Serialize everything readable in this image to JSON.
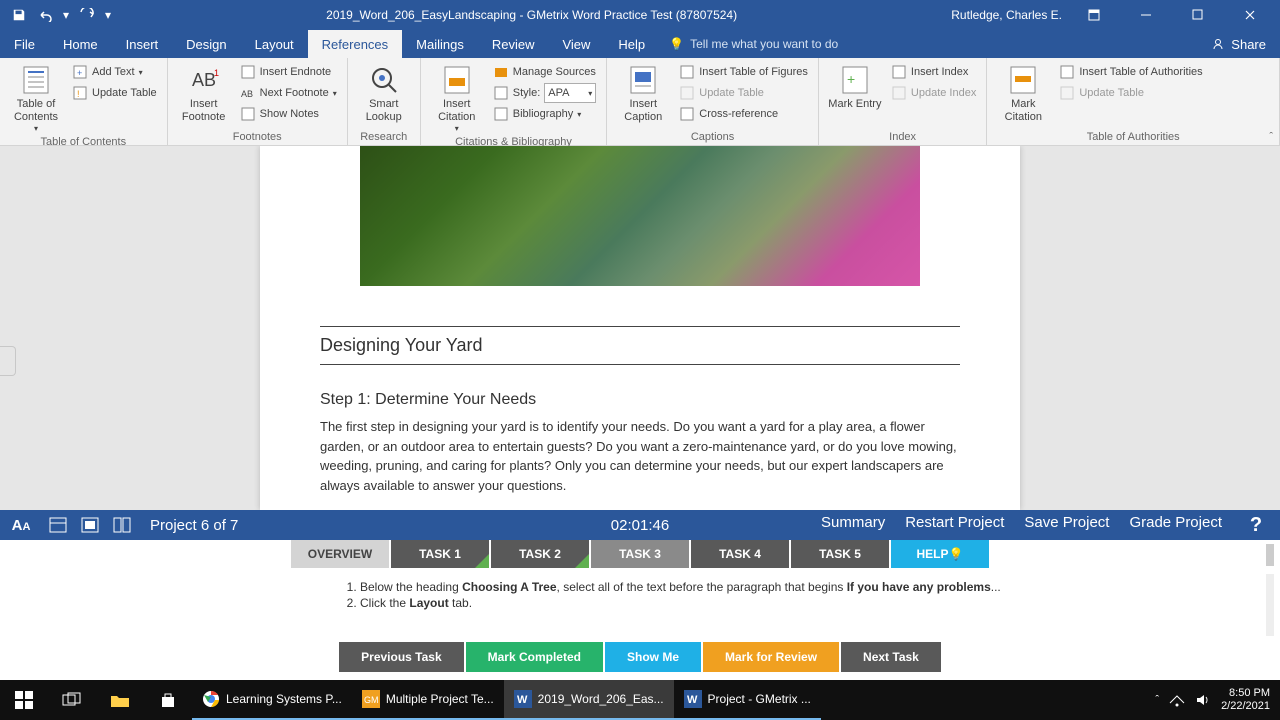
{
  "titlebar": {
    "doc_name": "2019_Word_206_EasyLandscaping",
    "app_name": "GMetrix Word Practice Test (87807524)",
    "user": "Rutledge, Charles E."
  },
  "menu": {
    "tabs": [
      "File",
      "Home",
      "Insert",
      "Design",
      "Layout",
      "References",
      "Mailings",
      "Review",
      "View",
      "Help"
    ],
    "active": "References",
    "tell_me": "Tell me what you want to do",
    "share": "Share"
  },
  "ribbon": {
    "toc": {
      "label": "Table of Contents",
      "big": "Table of Contents",
      "add_text": "Add Text",
      "update": "Update Table"
    },
    "footnotes": {
      "label": "Footnotes",
      "big": "Insert Footnote",
      "endnote": "Insert Endnote",
      "next": "Next Footnote",
      "show": "Show Notes"
    },
    "research": {
      "label": "Research",
      "big": "Smart Lookup"
    },
    "citations": {
      "label": "Citations & Bibliography",
      "big": "Insert Citation",
      "manage": "Manage Sources",
      "style": "Style:",
      "style_val": "APA",
      "biblio": "Bibliography"
    },
    "captions": {
      "label": "Captions",
      "big": "Insert Caption",
      "table_fig": "Insert Table of Figures",
      "update": "Update Table",
      "cross": "Cross-reference"
    },
    "index": {
      "label": "Index",
      "big": "Mark Entry",
      "insert": "Insert Index",
      "update": "Update Index"
    },
    "toa": {
      "label": "Table of Authorities",
      "big": "Mark Citation",
      "insert": "Insert Table of Authorities",
      "update": "Update Table"
    }
  },
  "document": {
    "section_title": "Designing Your Yard",
    "step_title": "Step 1: Determine Your Needs",
    "body": "The first step in designing your yard is to identify your needs. Do you want a yard for a play area, a flower garden, or an outdoor area to entertain guests? Do you want a zero-maintenance yard, or do you love mowing, weeding, pruning, and caring for plants? Only you can determine your needs, but our expert landscapers are always available to answer your questions."
  },
  "gmetrix": {
    "project": "Project 6 of 7",
    "timer": "02:01:46",
    "links": [
      "Summary",
      "Restart Project",
      "Save Project",
      "Grade Project"
    ],
    "tasks": {
      "overview": "OVERVIEW",
      "items": [
        "TASK 1",
        "TASK 2",
        "TASK 3",
        "TASK 4",
        "TASK 5"
      ],
      "help": "HELP",
      "active": 2,
      "checked": [
        0,
        1
      ]
    },
    "instructions": {
      "line1_pre": "Below the heading ",
      "line1_b1": "Choosing A Tree",
      "line1_mid": ", select all of the text before the paragraph that begins ",
      "line1_b2": "If you have any problems",
      "line1_post": "...",
      "line2_pre": "Click the ",
      "line2_b": "Layout",
      "line2_post": " tab."
    },
    "buttons": {
      "prev": "Previous Task",
      "complete": "Mark Completed",
      "show": "Show Me",
      "review": "Mark for Review",
      "next": "Next Task"
    }
  },
  "taskbar": {
    "apps": [
      {
        "name": "Learning Systems P..."
      },
      {
        "name": "Multiple Project Te..."
      },
      {
        "name": "2019_Word_206_Eas..."
      },
      {
        "name": "Project - GMetrix ..."
      }
    ],
    "time": "8:50 PM",
    "date": "2/22/2021"
  }
}
